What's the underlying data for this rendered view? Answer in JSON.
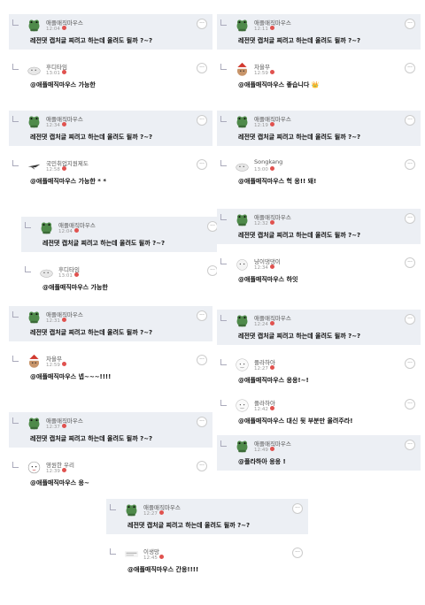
{
  "colors": {
    "highlight": "#eceff4",
    "badge": "#e0524f",
    "text": "#111111"
  },
  "cards": [
    {
      "comment": {
        "author": "애플매직마우스",
        "time": "12:04",
        "text": "레전댓 캡처글 찌려고 하는데 올려도 될까 ?~?",
        "avatar": "frog-avatar-icon"
      },
      "reply": {
        "author": "후디타임",
        "time": "13:01",
        "text": "@애플매직마우스 가능한",
        "avatar": "ghost-avatar-icon"
      }
    },
    {
      "comment": {
        "author": "애플매직마우스",
        "time": "12:11",
        "text": "레전댓 캡처글 찌려고 하는데 올려도 될까 ?~?",
        "avatar": "frog-avatar-icon"
      },
      "reply": {
        "author": "차을무",
        "time": "12:59",
        "text": "@애플매직마우스 좋습니다 👑",
        "avatar": "santa-avatar-icon"
      }
    },
    {
      "comment": {
        "author": "애플매직마우스",
        "time": "12:34",
        "text": "레전댓 캡처글 찌려고 하는데 올려도 될까 ?~?",
        "avatar": "frog-avatar-icon"
      },
      "reply": {
        "author": "국민취업지원제도",
        "time": "12:58",
        "text": "@애플매직마우스 가능한 * *",
        "avatar": "plane-avatar-icon"
      }
    },
    {
      "comment": {
        "author": "애플매직마우스",
        "time": "12:19",
        "text": "레전댓 캡처글 찌려고 하는데 올려도 될까 ?~?",
        "avatar": "frog-avatar-icon"
      },
      "reply": {
        "author": "Songkang",
        "time": "13:00",
        "text": "@애플매직마우스 헉 응!! 돼!",
        "avatar": "ghost-avatar-icon"
      }
    },
    {
      "comment": {
        "author": "애플매직마우스",
        "time": "12:04",
        "text": "레전댓 캡처글 찌려고 하는데 올려도 될까 ?~?",
        "avatar": "frog-avatar-icon"
      },
      "reply": {
        "author": "후디타임",
        "time": "13:01",
        "text": "@애플매직마우스 가능한",
        "avatar": "ghost-avatar-icon"
      }
    },
    {
      "comment": {
        "author": "애플매직마우스",
        "time": "12:32",
        "text": "레전댓 캡처글 찌려고 하는데 올려도 될까 ?~?",
        "avatar": "frog-avatar-icon"
      },
      "reply": {
        "author": "냥이댕댕이",
        "time": "12:34",
        "text": "@애플매직마우스 하잇",
        "avatar": "cat-avatar-icon"
      }
    },
    {
      "comment": {
        "author": "애플매직마우스",
        "time": "12:31",
        "text": "레전댓 캡처글 찌려고 하는데 올려도 될까 ?~?",
        "avatar": "frog-avatar-icon"
      },
      "reply": {
        "author": "차을무",
        "time": "12:59",
        "text": "@애플매직마우스 넵~~~!!!!",
        "avatar": "santa-avatar-icon"
      }
    },
    {
      "comment": {
        "author": "애플매직마우스",
        "time": "12:24",
        "text": "레전댓 캡처글 찌려고 하는데 올려도 될까 ?~?",
        "avatar": "frog-avatar-icon"
      },
      "reply": {
        "author": "플라하아",
        "time": "12:27",
        "text": "@애플매직마우스 응응!~!",
        "avatar": "face-avatar-icon"
      },
      "reply2": {
        "author": "플라하아",
        "time": "12:42",
        "text": "@애플매직마우스 대신 뒷 부분만 올려주라!",
        "avatar": "face-avatar-icon"
      },
      "reply3": {
        "author": "애플매직마우스",
        "time": "12:49",
        "text": "@플라하아 응응 !",
        "avatar": "frog-avatar-icon"
      }
    },
    {
      "comment": {
        "author": "애플매직마우스",
        "time": "12:37",
        "text": "레전댓 캡처글 찌려고 하는데 올려도 될까 ?~?",
        "avatar": "frog-avatar-icon"
      },
      "reply": {
        "author": "영원한 우리",
        "time": "12:39",
        "text": "@애플매직마우스 응~",
        "avatar": "baby-avatar-icon"
      }
    },
    {
      "comment": {
        "author": "애플매직마우스",
        "time": "12:27",
        "text": "레전댓 캡처글 찌려고 하는데 올려도 될까 ?~?",
        "avatar": "frog-avatar-icon"
      },
      "reply": {
        "author": "이생망",
        "time": "12:45",
        "text": "@애플매직마우스 간응!!!!",
        "avatar": "text-avatar-icon"
      }
    }
  ],
  "more_label": "···"
}
